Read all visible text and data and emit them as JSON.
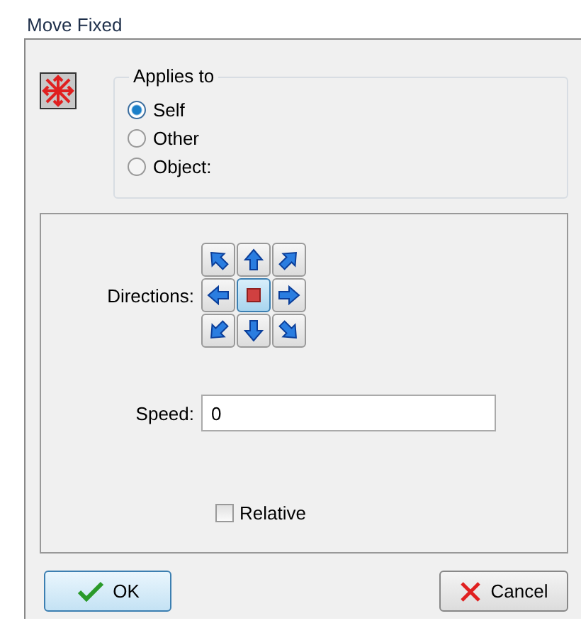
{
  "window": {
    "title": "Move Fixed"
  },
  "applies_to": {
    "label": "Applies to",
    "options": [
      {
        "label": "Self",
        "selected": true
      },
      {
        "label": "Other",
        "selected": false
      },
      {
        "label": "Object:",
        "selected": false
      }
    ]
  },
  "directions": {
    "label": "Directions:",
    "buttons": [
      {
        "kind": "up-left",
        "selected": false
      },
      {
        "kind": "up",
        "selected": false
      },
      {
        "kind": "up-right",
        "selected": false
      },
      {
        "kind": "left",
        "selected": false
      },
      {
        "kind": "stop",
        "selected": true
      },
      {
        "kind": "right",
        "selected": false
      },
      {
        "kind": "down-left",
        "selected": false
      },
      {
        "kind": "down",
        "selected": false
      },
      {
        "kind": "down-right",
        "selected": false
      }
    ]
  },
  "speed": {
    "label": "Speed:",
    "value": "0"
  },
  "relative": {
    "label": "Relative",
    "checked": false
  },
  "buttons": [
    {
      "kind": "ok",
      "label": "OK"
    },
    {
      "kind": "cancel",
      "label": "Cancel"
    }
  ]
}
